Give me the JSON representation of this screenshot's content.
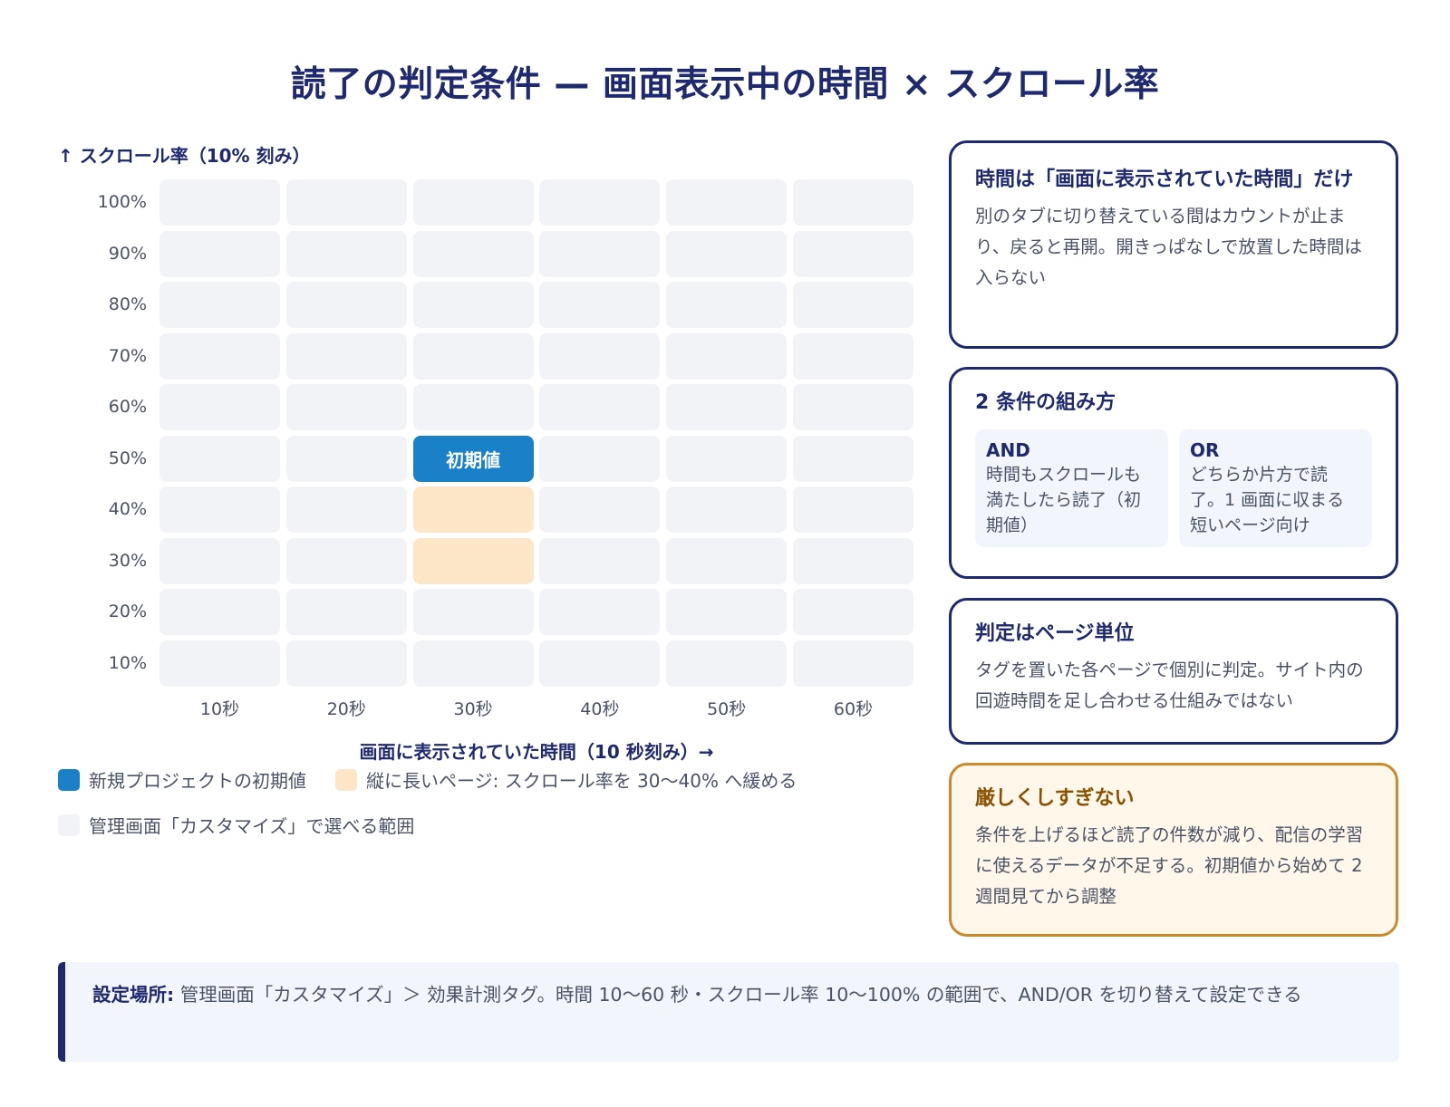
{
  "title": "読了の判定条件 — 画面表示中の時間 × スクロール率",
  "chart_data": {
    "type": "heatmap",
    "ylabel": "↑ スクロール率（10% 刻み）",
    "xlabel": "画面に表示されていた時間（10 秒刻み）→",
    "y_ticks": [
      "100%",
      "90%",
      "80%",
      "70%",
      "60%",
      "50%",
      "40%",
      "30%",
      "20%",
      "10%"
    ],
    "x_ticks": [
      "10秒",
      "20秒",
      "30秒",
      "40秒",
      "50秒",
      "60秒"
    ],
    "highlights": [
      {
        "time": "30秒",
        "scroll": "50%",
        "kind": "initial",
        "label": "初期値"
      },
      {
        "time": "30秒",
        "scroll": "40%",
        "kind": "relaxed",
        "label": ""
      },
      {
        "time": "30秒",
        "scroll": "30%",
        "kind": "relaxed",
        "label": ""
      }
    ],
    "legend": [
      {
        "label": "新規プロジェクトの初期値",
        "color": "#1a80c8"
      },
      {
        "label": "縦に長いページ: スクロール率を 30〜40% へ緩める",
        "color": "#fde6c8"
      },
      {
        "label": "管理画面「カスタマイズ」で選べる範囲",
        "color": "#f1f3f7"
      }
    ]
  },
  "cards": {
    "time": {
      "title": "時間は「画面に表示されていた時間」だけ",
      "body": "別のタブに切り替えている間はカウントが止まり、戻ると再開。開きっぱなしで放置した時間は入らない"
    },
    "combine": {
      "title": "2 条件の組み方",
      "and_title": "AND",
      "and_desc": "時間もスクロールも満たしたら読了（初期値）",
      "or_title": "OR",
      "or_desc": "どちらか片方で読了。1 画面に収まる短いページ向け"
    },
    "page": {
      "title": "判定はページ単位",
      "body": "タグを置いた各ページで個別に判定。サイト内の回遊時間を足し合わせる仕組みではない"
    },
    "strict": {
      "title": "厳しくしすぎない",
      "body": "条件を上げるほど読了の件数が減り、配信の学習に使えるデータが不足する。初期値から始めて 2 週間見てから調整"
    }
  },
  "note": {
    "label": "設定場所:",
    "text": " 管理画面「カスタマイズ」＞ 効果計測タグ。時間 10〜60 秒・スクロール率 10〜100% の範囲で、AND/OR を切り替えて設定できる"
  }
}
